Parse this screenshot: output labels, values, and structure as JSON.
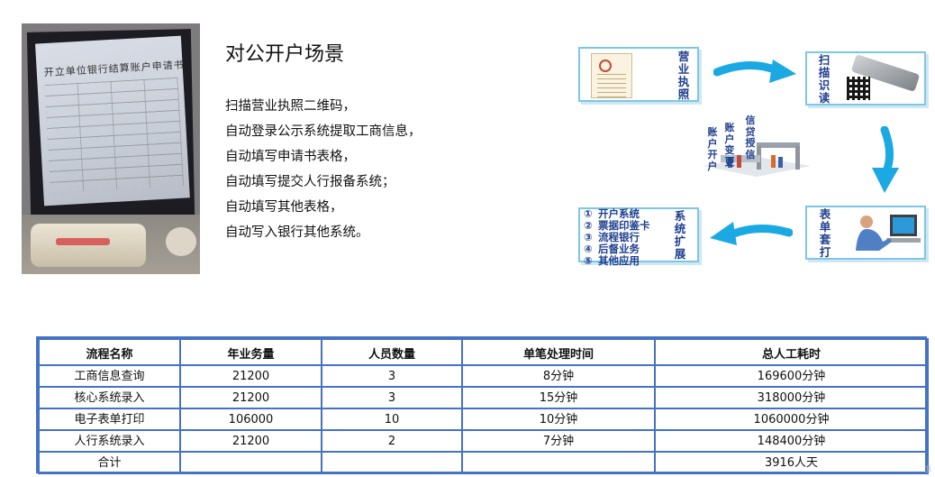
{
  "photo": {
    "form_title": "开立单位银行结算账户申请书"
  },
  "scene": {
    "title": "对公开户场景",
    "lines": [
      "扫描营业执照二维码，",
      "自动登录公示系统提取工商信息，",
      "自动填写申请书表格，",
      "自动填写提交人行报备系统；",
      "自动填写其他表格，",
      "自动写入银行其他系统。"
    ]
  },
  "diagram": {
    "license_label": "营业执照",
    "scan_label": "扫描识读",
    "print_label": "表单套打",
    "extend_label": "系统扩展",
    "center_labels": [
      "账户开户",
      "账户变更",
      "信贷授信"
    ],
    "extend_items": [
      {
        "num": "①",
        "text": "开户系统"
      },
      {
        "num": "②",
        "text": "票据印鉴卡"
      },
      {
        "num": "③",
        "text": "流程银行"
      },
      {
        "num": "④",
        "text": "后督业务"
      },
      {
        "num": "⑤",
        "text": "其他应用"
      }
    ],
    "colors": {
      "arrow": "#1aa9e3",
      "box_border": "#7cc6e6",
      "label": "#1f3f8f"
    }
  },
  "table": {
    "headers": [
      "流程名称",
      "年业务量",
      "人员数量",
      "单笔处理时间",
      "总人工耗时"
    ],
    "rows": [
      [
        "工商信息查询",
        "21200",
        "3",
        "8分钟",
        "169600分钟"
      ],
      [
        "核心系统录入",
        "21200",
        "3",
        "15分钟",
        "318000分钟"
      ],
      [
        "电子表单打印",
        "106000",
        "10",
        "10分钟",
        "1060000分钟"
      ],
      [
        "人行系统录入",
        "21200",
        "2",
        "7分钟",
        "148400分钟"
      ],
      [
        "合计",
        "",
        "",
        "",
        "3916人天"
      ]
    ],
    "border_color": "#4472c4"
  },
  "corner_mark": "ℬ"
}
